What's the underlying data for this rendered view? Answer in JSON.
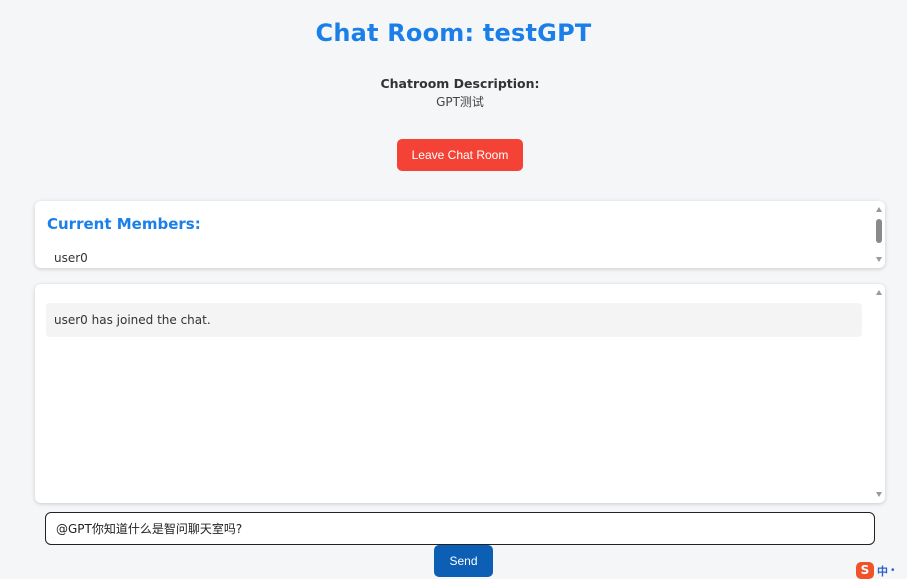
{
  "header": {
    "title": "Chat Room: testGPT",
    "description_label": "Chatroom Description:",
    "description_text": "GPT测试",
    "leave_label": "Leave Chat Room"
  },
  "members": {
    "title": "Current Members:",
    "items": [
      "user0"
    ]
  },
  "messages": [
    {
      "text": "user0 has joined the chat."
    }
  ],
  "composer": {
    "input_value": "@GPT你知道什么是智问聊天室吗?",
    "send_label": "Send"
  },
  "ime": {
    "logo": "S",
    "mode": "中",
    "extra": "•"
  },
  "colors": {
    "accent": "#1a7fe8",
    "leave_button": "#f44336",
    "send_button": "#0d5fb5"
  }
}
